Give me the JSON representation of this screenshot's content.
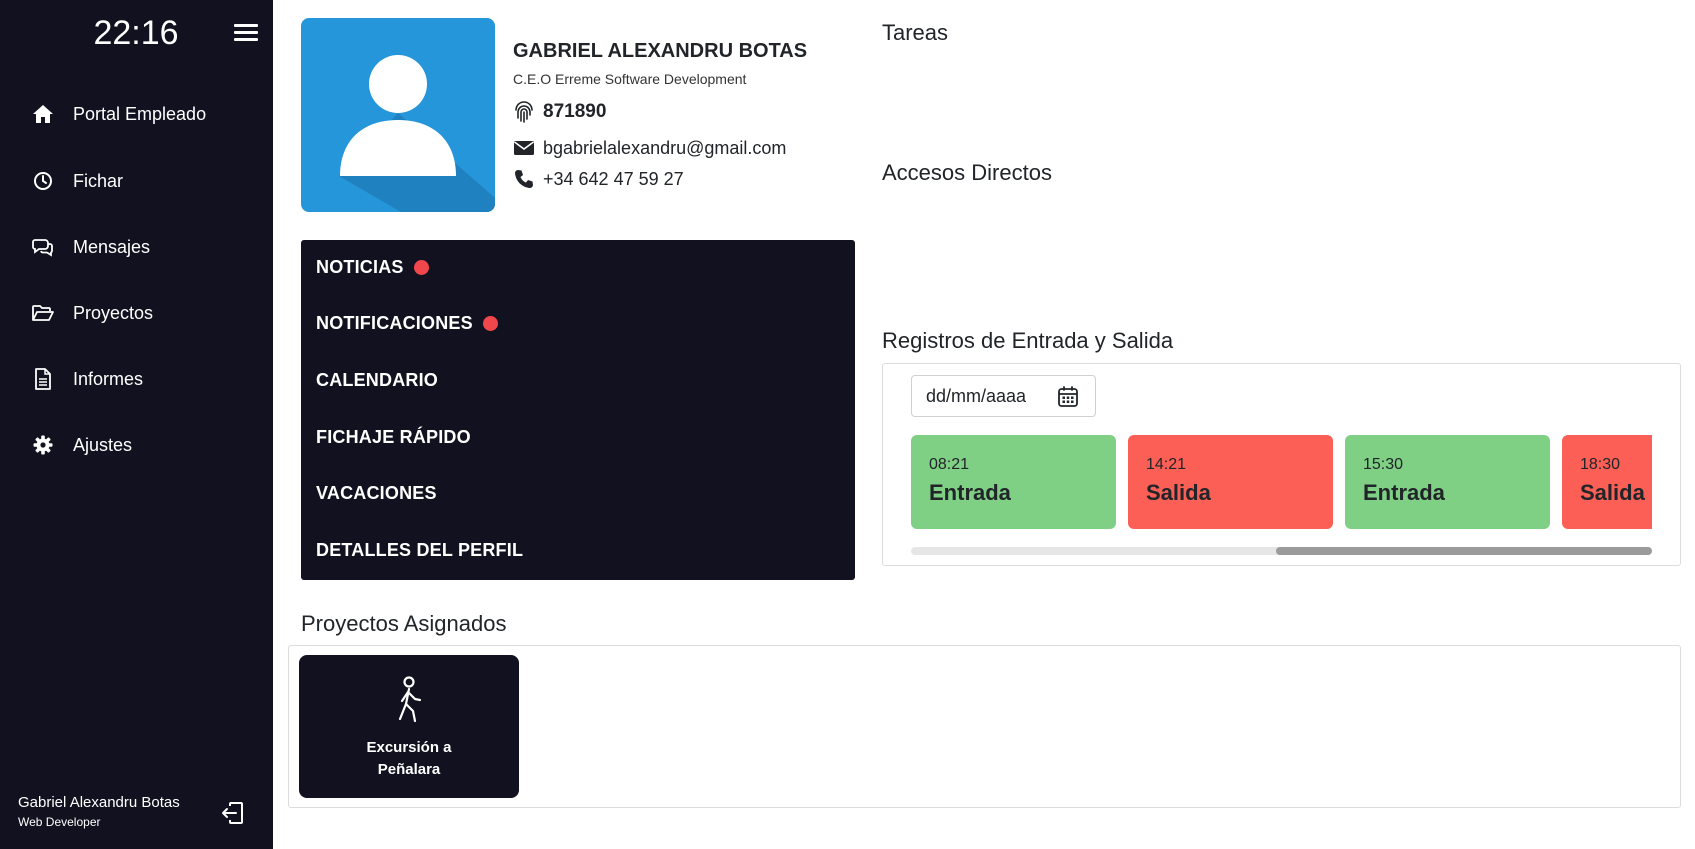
{
  "sidebar": {
    "clock": "22:16",
    "items": [
      {
        "label": "Portal Empleado",
        "icon": "home-icon"
      },
      {
        "label": "Fichar",
        "icon": "clock-icon"
      },
      {
        "label": "Mensajes",
        "icon": "chat-icon"
      },
      {
        "label": "Proyectos",
        "icon": "folder-open-icon"
      },
      {
        "label": "Informes",
        "icon": "document-icon"
      },
      {
        "label": "Ajustes",
        "icon": "gear-icon"
      }
    ],
    "user": {
      "name": "Gabriel Alexandru Botas",
      "role": "Web Developer"
    }
  },
  "profile": {
    "name": "GABRIEL ALEXANDRU BOTAS",
    "title": "C.E.O Erreme Software Development",
    "employee_id": "871890",
    "email": "bgabrielalexandru@gmail.com",
    "phone": "+34 642 47 59 27"
  },
  "quick_menu": [
    {
      "label": "NOTICIAS",
      "badge": true
    },
    {
      "label": "NOTIFICACIONES",
      "badge": true
    },
    {
      "label": "CALENDARIO",
      "badge": false
    },
    {
      "label": "FICHAJE RÁPIDO",
      "badge": false
    },
    {
      "label": "VACACIONES",
      "badge": false
    },
    {
      "label": "DETALLES DEL PERFIL",
      "badge": false
    }
  ],
  "sections": {
    "tasks": "Tareas",
    "shortcuts": "Accesos Directos",
    "records": "Registros de Entrada y Salida",
    "projects": "Proyectos Asignados"
  },
  "records": {
    "date_placeholder": "dd/mm/aaaa",
    "entries": [
      {
        "time": "08:21",
        "type": "Entrada",
        "status": "in"
      },
      {
        "time": "14:21",
        "type": "Salida",
        "status": "out"
      },
      {
        "time": "15:30",
        "type": "Entrada",
        "status": "in"
      },
      {
        "time": "18:30",
        "type": "Salida",
        "status": "out"
      }
    ],
    "scroll_position": 0.49
  },
  "projects": [
    {
      "label": "Excursión a Peñalara",
      "icon": "walking-person-icon"
    }
  ],
  "colors": {
    "sidebar_bg": "#11111f",
    "avatar_bg": "#2596d9",
    "badge_red": "#f0464c",
    "entry_green": "#7fcf84",
    "exit_red": "#fc5f55"
  }
}
